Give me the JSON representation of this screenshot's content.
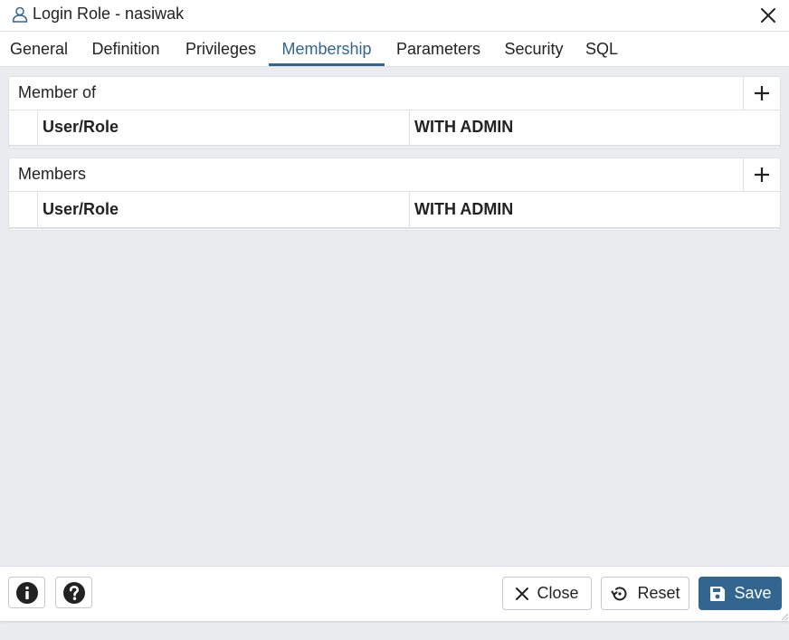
{
  "window": {
    "title": "Login Role - nasiwak",
    "title_icon": "user-icon",
    "close_icon": "close-icon"
  },
  "tabs": [
    {
      "label": "General",
      "active": false
    },
    {
      "label": "Definition",
      "active": false
    },
    {
      "label": "Privileges",
      "active": false
    },
    {
      "label": "Membership",
      "active": true
    },
    {
      "label": "Parameters",
      "active": false
    },
    {
      "label": "Security",
      "active": false
    },
    {
      "label": "SQL",
      "active": false
    }
  ],
  "member_of": {
    "title": "Member of",
    "add_icon": "plus-icon",
    "columns": [
      "User/Role",
      "WITH ADMIN"
    ]
  },
  "members": {
    "title": "Members",
    "add_icon": "plus-icon",
    "columns": [
      "User/Role",
      "WITH ADMIN"
    ]
  },
  "footer": {
    "info_icon": "info-icon",
    "help_icon": "help-icon",
    "close_label": "Close",
    "reset_label": "Reset",
    "save_label": "Save"
  },
  "colors": {
    "accent": "#326690",
    "background": "#ebecf0",
    "border": "#dde0e6"
  }
}
